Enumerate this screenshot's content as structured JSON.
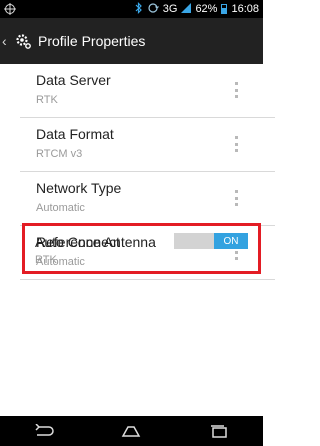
{
  "status_bar": {
    "network": "3G",
    "battery": "62%",
    "time": "16:08",
    "battery_level": 0.62,
    "accent_color": "#3aa6e6"
  },
  "action_bar": {
    "title": "Profile Properties",
    "back_icon": "chevron-left-icon",
    "app_icon": "gear-icon"
  },
  "settings": [
    {
      "title": "Data Server",
      "value": "RTK"
    },
    {
      "title": "Data Format",
      "value": "RTCM v3"
    },
    {
      "title": "Network Type",
      "value": "Automatic"
    },
    {
      "title": "Reference Antenna",
      "value": "Automatic"
    }
  ],
  "auto_connect": {
    "title": "Auto Connect",
    "value": "RTK",
    "toggle_label": "ON",
    "toggle_color": "#33a2e0",
    "highlight_color": "#e31c24"
  },
  "nav_bar": {
    "buttons": [
      "back-icon",
      "home-icon",
      "recent-apps-icon"
    ]
  }
}
